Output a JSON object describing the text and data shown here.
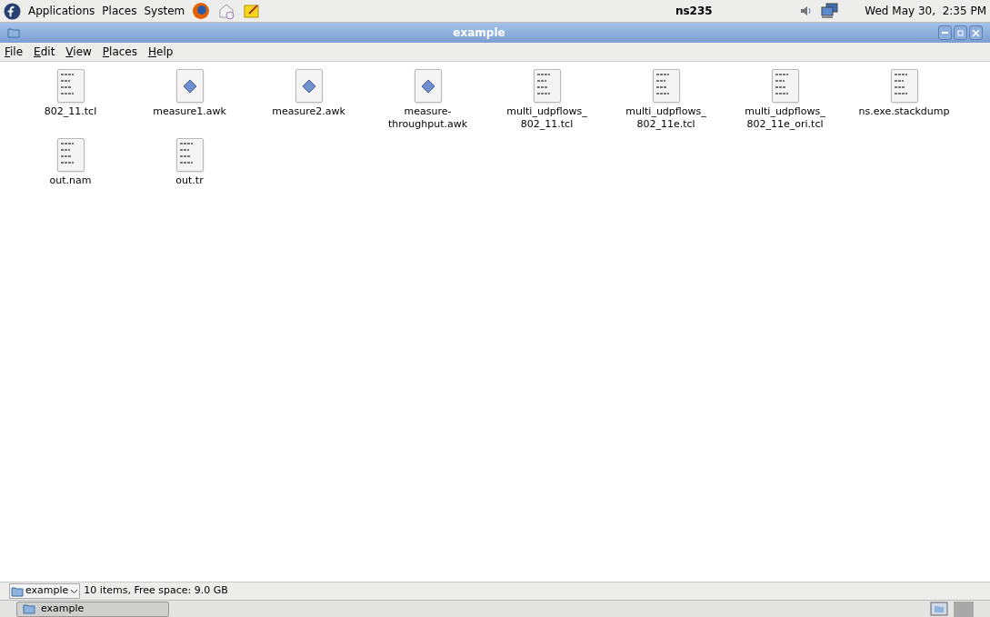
{
  "top_panel": {
    "menus": [
      "Applications",
      "Places",
      "System"
    ],
    "hostname": "ns235",
    "clock": "Wed May 30,  2:35 PM"
  },
  "window": {
    "title": "example"
  },
  "menu_bar": [
    "File",
    "Edit",
    "View",
    "Places",
    "Help"
  ],
  "files": [
    {
      "name": "802_11.tcl",
      "kind": "text"
    },
    {
      "name": "measure1.awk",
      "kind": "script"
    },
    {
      "name": "measure2.awk",
      "kind": "script"
    },
    {
      "name": "measure-\nthroughput.awk",
      "kind": "script"
    },
    {
      "name": "multi_udpflows_\n802_11.tcl",
      "kind": "text"
    },
    {
      "name": "multi_udpflows_\n802_11e.tcl",
      "kind": "text"
    },
    {
      "name": "multi_udpflows_\n802_11e_ori.tcl",
      "kind": "text"
    },
    {
      "name": "ns.exe.stackdump",
      "kind": "text"
    },
    {
      "name": "out.nam",
      "kind": "text"
    },
    {
      "name": "out.tr",
      "kind": "text"
    }
  ],
  "status_bar": {
    "location": "example",
    "info": "10 items, Free space: 9.0 GB"
  },
  "taskbar": {
    "items": [
      {
        "label": "example",
        "selected": true
      }
    ]
  }
}
